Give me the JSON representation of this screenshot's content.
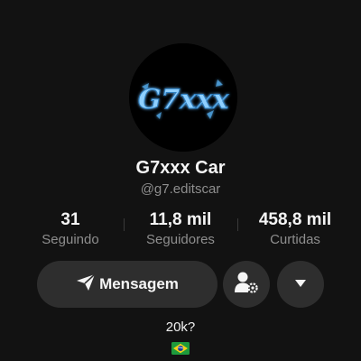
{
  "profile": {
    "display_name": "G7xxx Car",
    "handle": "@g7.editscar",
    "avatar_text": "G7xxx",
    "bio": "20k?",
    "bio_emoji": "brazil-flag-icon"
  },
  "stats": {
    "following": {
      "value": "31",
      "label": "Seguindo"
    },
    "followers": {
      "value": "11,8 mil",
      "label": "Seguidores"
    },
    "likes": {
      "value": "458,8 mil",
      "label": "Curtidas"
    }
  },
  "actions": {
    "message_label": "Mensagem",
    "message_icon": "send-icon",
    "suggest_icon": "person-settings-icon",
    "more_icon": "caret-down-icon"
  },
  "colors": {
    "background": "#121212",
    "button": "#2e2e2e",
    "secondary_text": "#8e8e8e",
    "avatar_accent": "#7ec8ff"
  }
}
